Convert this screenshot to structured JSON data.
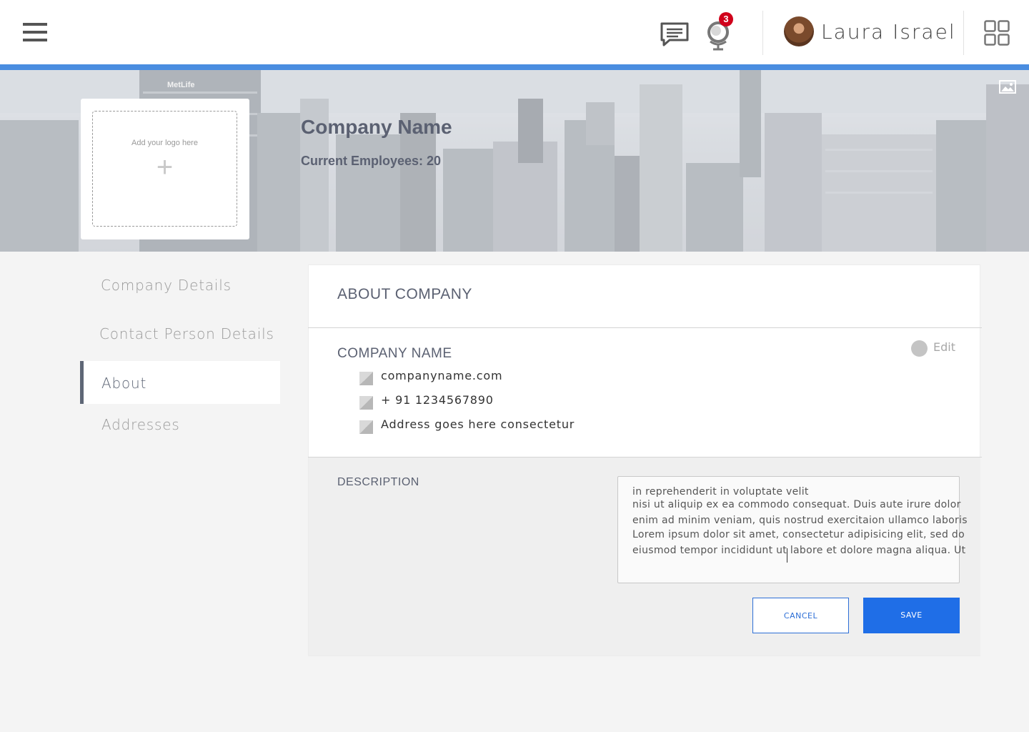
{
  "header": {
    "user_name": "Laura Israel",
    "notification_count": "3",
    "icons": [
      "menu-icon",
      "chat-icon",
      "globe-icon",
      "apps-grid-icon"
    ]
  },
  "banner": {
    "company_name": "Company Name",
    "employees": "Current Employees: 20",
    "logo_hint": "Add your logo here",
    "logo_plus": "+",
    "building_sign": "MetLife"
  },
  "sidebar": {
    "items": [
      {
        "label": "Company Details",
        "active": false
      },
      {
        "label": "Contact Person Details",
        "active": false
      },
      {
        "label": "About",
        "active": true
      },
      {
        "label": "Addresses",
        "active": false
      }
    ]
  },
  "card": {
    "title": "ABOUT COMPANY",
    "section_label": "COMPANY NAME",
    "edit_label": "Edit",
    "info": [
      "companyname.com",
      "+ 91 1234567890",
      "Address goes here consectetur"
    ],
    "description_label": "DESCRIPTION",
    "description_lines": [
      "in reprehenderit in voluptate velit",
      "nisi ut aliquip ex ea commodo consequat. Duis aute irure dolor",
      "enim ad minim veniam, quis nostrud exercitaion ullamco laboris",
      "Lorem ipsum dolor sit amet, consectetur adipisicing elit, sed do",
      "eiusmod tempor incididunt ut labore et dolore magna aliqua. Ut"
    ],
    "cancel_label": "CANCEL",
    "save_label": "SAVE"
  },
  "colors": {
    "accent_blue": "#1f6ee7",
    "header_bar": "#4a8de0",
    "badge_red": "#d0021b",
    "text_slate": "#5b6172"
  }
}
